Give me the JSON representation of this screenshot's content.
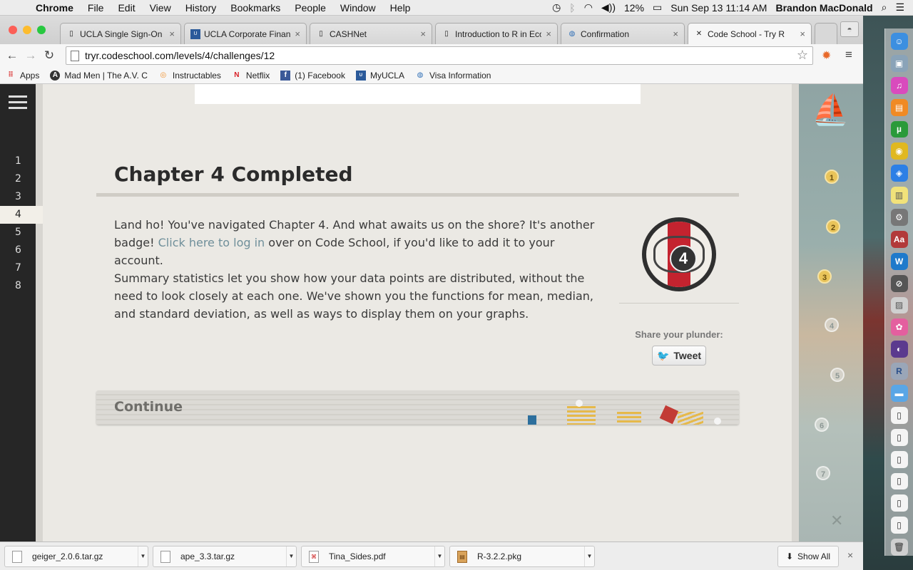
{
  "menubar": {
    "app": "Chrome",
    "menus": [
      "File",
      "Edit",
      "View",
      "History",
      "Bookmarks",
      "People",
      "Window",
      "Help"
    ],
    "battery": "12%",
    "datetime": "Sun Sep 13  11:14 AM",
    "user": "Brandon MacDonald"
  },
  "tabs": [
    {
      "title": "UCLA Single Sign-On"
    },
    {
      "title": "UCLA Corporate Financ"
    },
    {
      "title": "CASHNet"
    },
    {
      "title": "Introduction to R in Eco"
    },
    {
      "title": "Confirmation"
    },
    {
      "title": "Code School - Try R"
    }
  ],
  "address": {
    "url": "tryr.codeschool.com/levels/4/challenges/12"
  },
  "bookmarks": [
    {
      "label": "Apps"
    },
    {
      "label": "Mad Men | The A.V. C"
    },
    {
      "label": "Instructables"
    },
    {
      "label": "Netflix"
    },
    {
      "label": "(1) Facebook"
    },
    {
      "label": "MyUCLA"
    },
    {
      "label": "Visa Information"
    }
  ],
  "levels": [
    "1",
    "2",
    "3",
    "4",
    "5",
    "6",
    "7",
    "8"
  ],
  "page": {
    "title": "Chapter 4 Completed",
    "p1_text": "Land ho! You've navigated Chapter 4. And what awaits us on the shore? It's another badge!",
    "p1_link": "Click here to log in",
    "p1_tail": " over on Code School, if you'd like to add it to your account.",
    "p2": "Summary statistics let you show how your data points are distributed, without the need to look closely at each one. We've shown you the functions for mean, median, and standard deviation, as well as ways to display them on your graphs.",
    "badge_number": "4",
    "share_label": "Share your plunder:",
    "tweet_label": "Tweet",
    "continue_label": "Continue"
  },
  "map_stops": [
    "1",
    "2",
    "3",
    "4",
    "5",
    "6",
    "7"
  ],
  "downloads": [
    {
      "name": "geiger_2.0.6.tar.gz"
    },
    {
      "name": "ape_3.3.tar.gz"
    },
    {
      "name": "Tina_Sides.pdf"
    },
    {
      "name": "R-3.2.2.pkg"
    }
  ],
  "show_all": "Show All",
  "colors": {
    "accent_link": "#6f8f9a",
    "badge_red": "#c4232f",
    "stop_gold": "#e9c45a"
  }
}
